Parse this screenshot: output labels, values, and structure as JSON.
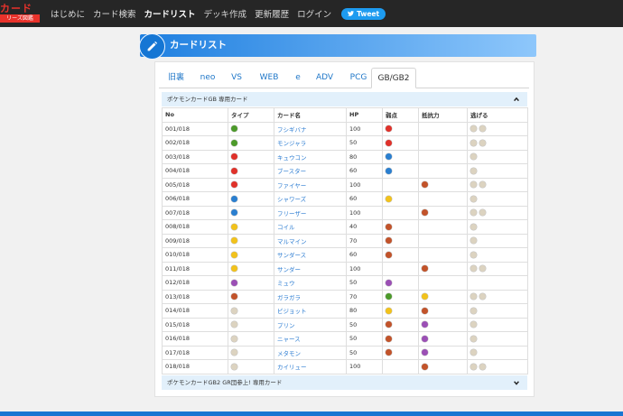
{
  "header": {
    "logo_text": "カード",
    "logo_sub": "リーズ図鑑",
    "nav": [
      "はじめに",
      "カード検索",
      "カードリスト",
      "デッキ作成",
      "更新履歴",
      "ログイン"
    ],
    "active_nav": 2,
    "tweet_label": "Tweet"
  },
  "page_title": "カードリスト",
  "tabs": [
    "旧裏",
    "neo",
    "VS",
    "WEB",
    "e",
    "ADV",
    "PCG",
    "GB/GB2"
  ],
  "active_tab": 7,
  "section1_title": "ポケモンカードGB 専用カード",
  "section2_title": "ポケモンカードGB2 GR団参上! 専用カード",
  "columns": [
    "No",
    "タイプ",
    "カード名",
    "HP",
    "弱点",
    "抵抗力",
    "逃げる"
  ],
  "colors": {
    "grass": "#4c9a2a",
    "fire": "#e0312a",
    "water": "#2a7fd0",
    "lightning": "#f2c21b",
    "psychic": "#9b4fb5",
    "fighting": "#c2532a",
    "colorless": "#dcd3c0",
    "link": "#2d7dd2",
    "accent": "#1e7fe0"
  },
  "rows": [
    {
      "no": "001/018",
      "type": "grass",
      "name": "フシギバナ",
      "hp": "100",
      "weak": [
        "fire"
      ],
      "resist": [],
      "retreat": 2
    },
    {
      "no": "002/018",
      "type": "grass",
      "name": "モンジャラ",
      "hp": "50",
      "weak": [
        "fire"
      ],
      "resist": [],
      "retreat": 2
    },
    {
      "no": "003/018",
      "type": "fire",
      "name": "キュウコン",
      "hp": "80",
      "weak": [
        "water"
      ],
      "resist": [],
      "retreat": 1
    },
    {
      "no": "004/018",
      "type": "fire",
      "name": "ブースター",
      "hp": "60",
      "weak": [
        "water"
      ],
      "resist": [],
      "retreat": 1
    },
    {
      "no": "005/018",
      "type": "fire",
      "name": "ファイヤー",
      "hp": "100",
      "weak": [],
      "resist": [
        "fighting"
      ],
      "retreat": 2
    },
    {
      "no": "006/018",
      "type": "water",
      "name": "シャワーズ",
      "hp": "60",
      "weak": [
        "lightning"
      ],
      "resist": [],
      "retreat": 1
    },
    {
      "no": "007/018",
      "type": "water",
      "name": "フリーザー",
      "hp": "100",
      "weak": [],
      "resist": [
        "fighting"
      ],
      "retreat": 2
    },
    {
      "no": "008/018",
      "type": "lightning",
      "name": "コイル",
      "hp": "40",
      "weak": [
        "fighting"
      ],
      "resist": [],
      "retreat": 1
    },
    {
      "no": "009/018",
      "type": "lightning",
      "name": "マルマイン",
      "hp": "70",
      "weak": [
        "fighting"
      ],
      "resist": [],
      "retreat": 1
    },
    {
      "no": "010/018",
      "type": "lightning",
      "name": "サンダース",
      "hp": "60",
      "weak": [
        "fighting"
      ],
      "resist": [],
      "retreat": 1
    },
    {
      "no": "011/018",
      "type": "lightning",
      "name": "サンダー",
      "hp": "100",
      "weak": [],
      "resist": [
        "fighting"
      ],
      "retreat": 2
    },
    {
      "no": "012/018",
      "type": "psychic",
      "name": "ミュウ",
      "hp": "50",
      "weak": [
        "psychic"
      ],
      "resist": [],
      "retreat": 0
    },
    {
      "no": "013/018",
      "type": "fighting",
      "name": "ガラガラ",
      "hp": "70",
      "weak": [
        "grass"
      ],
      "resist": [
        "lightning"
      ],
      "retreat": 2
    },
    {
      "no": "014/018",
      "type": "colorless",
      "name": "ピジョット",
      "hp": "80",
      "weak": [
        "lightning"
      ],
      "resist": [
        "fighting"
      ],
      "retreat": 1
    },
    {
      "no": "015/018",
      "type": "colorless",
      "name": "プリン",
      "hp": "50",
      "weak": [
        "fighting"
      ],
      "resist": [
        "psychic"
      ],
      "retreat": 1
    },
    {
      "no": "016/018",
      "type": "colorless",
      "name": "ニャース",
      "hp": "50",
      "weak": [
        "fighting"
      ],
      "resist": [
        "psychic"
      ],
      "retreat": 1
    },
    {
      "no": "017/018",
      "type": "colorless",
      "name": "メタモン",
      "hp": "50",
      "weak": [
        "fighting"
      ],
      "resist": [
        "psychic"
      ],
      "retreat": 1
    },
    {
      "no": "018/018",
      "type": "colorless",
      "name": "カイリュー",
      "hp": "100",
      "weak": [],
      "resist": [
        "fighting"
      ],
      "retreat": 2
    }
  ]
}
